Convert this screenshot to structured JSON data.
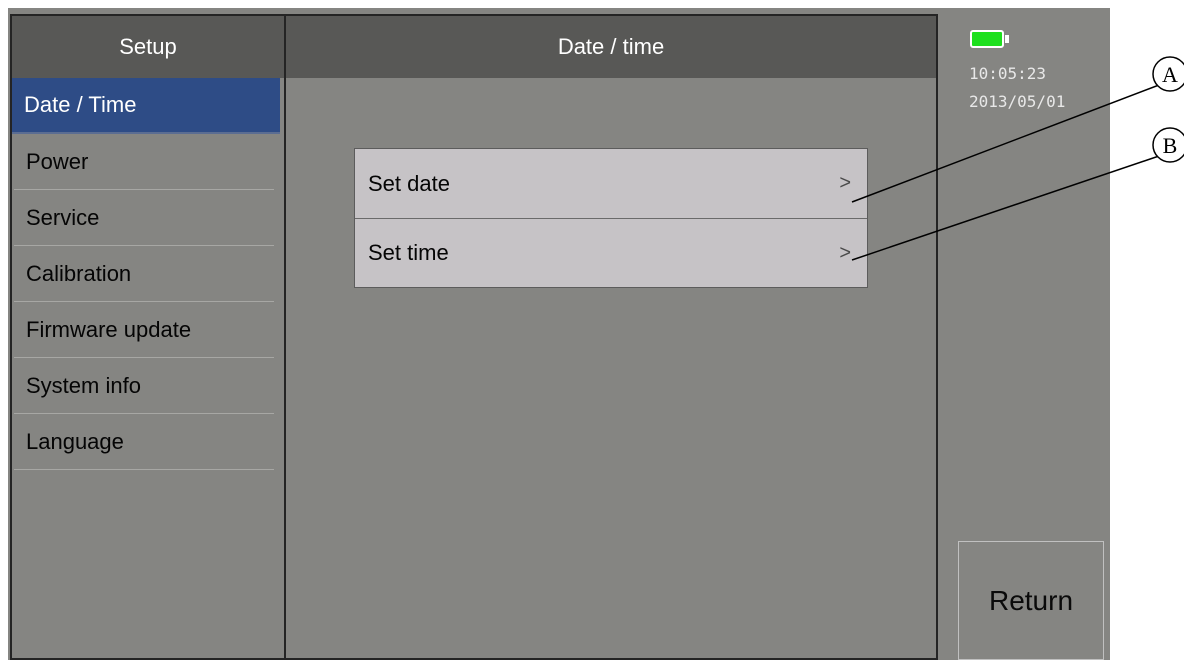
{
  "sidebar": {
    "title": "Setup",
    "items": [
      {
        "label": "Date / Time",
        "active": true
      },
      {
        "label": "Power"
      },
      {
        "label": "Service"
      },
      {
        "label": "Calibration"
      },
      {
        "label": "Firmware update"
      },
      {
        "label": "System info"
      },
      {
        "label": "Language"
      }
    ]
  },
  "main": {
    "title": "Date / time",
    "options": [
      {
        "label": "Set date",
        "chevron": ">"
      },
      {
        "label": "Set time",
        "chevron": ">"
      }
    ]
  },
  "status": {
    "battery_icon": "battery-full-icon",
    "battery_color": "#1ee01e",
    "time": "10:05:23",
    "date": "2013/05/01"
  },
  "return_button": {
    "label": "Return"
  },
  "callouts": [
    {
      "label": "A"
    },
    {
      "label": "B"
    }
  ],
  "colors": {
    "screen_bg": "#858582",
    "header_bg": "#585856",
    "active_item_bg": "#2e4c86",
    "option_bg": "#c6c3c6"
  }
}
